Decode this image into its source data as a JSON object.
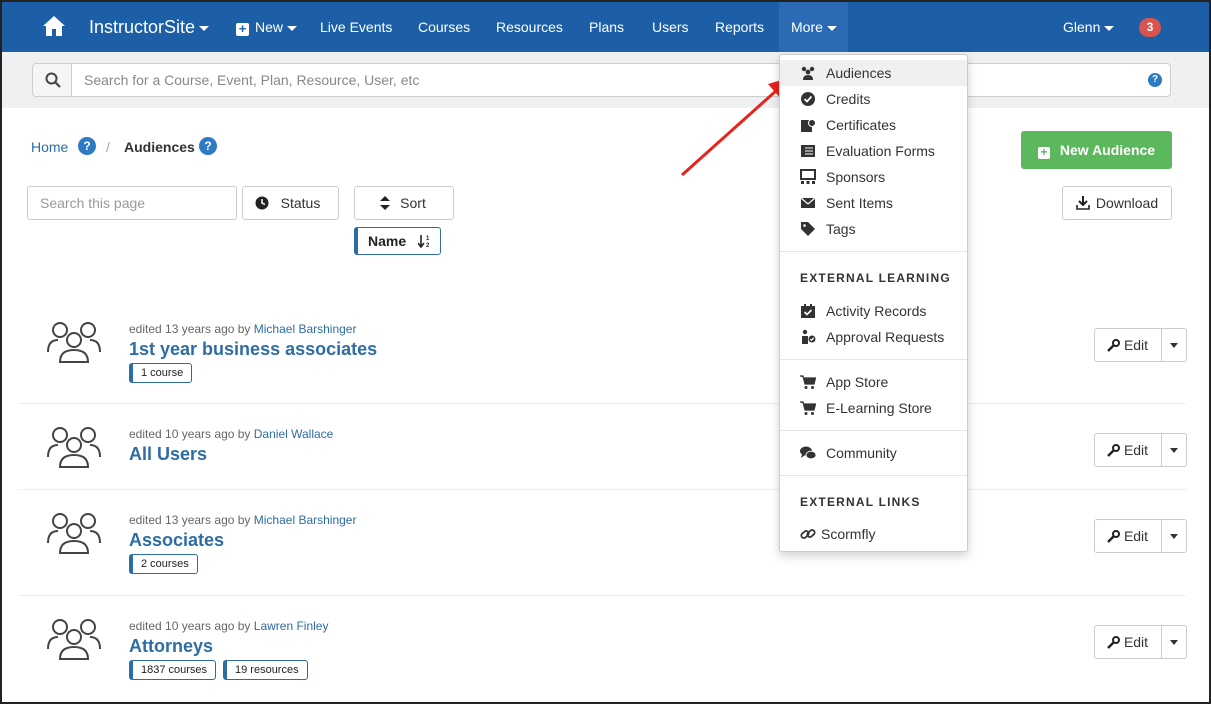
{
  "nav": {
    "brand": "InstructorSite",
    "new_label": "New",
    "items": [
      "Live Events",
      "Courses",
      "Resources",
      "Plans",
      "Users",
      "Reports"
    ],
    "more_label": "More",
    "user_label": "Glenn",
    "notification_count": "3"
  },
  "search": {
    "placeholder": "Search for a Course, Event, Plan, Resource, User, etc",
    "help": "?"
  },
  "breadcrumb": {
    "home": "Home",
    "current": "Audiences",
    "help": "?"
  },
  "toolbar": {
    "new_audience": "New Audience",
    "search_placeholder": "Search this page",
    "status_label": "Status",
    "sort_label": "Sort",
    "download_label": "Download",
    "sort_pill": "Name"
  },
  "audiences": [
    {
      "meta_prefix": "edited 13 years ago by ",
      "author": "Michael Barshinger",
      "name": "1st year business associates",
      "pills": [
        "1 course"
      ],
      "edit": "Edit"
    },
    {
      "meta_prefix": "edited 10 years ago by ",
      "author": "Daniel Wallace",
      "name": "All Users",
      "pills": [],
      "edit": "Edit"
    },
    {
      "meta_prefix": "edited 13 years ago by ",
      "author": "Michael Barshinger",
      "name": "Associates",
      "pills": [
        "2 courses"
      ],
      "edit": "Edit"
    },
    {
      "meta_prefix": "edited 10 years ago by ",
      "author": "Lawren Finley",
      "name": "Attorneys",
      "pills": [
        "1837 courses",
        "19 resources"
      ],
      "edit": "Edit"
    }
  ],
  "more_menu": {
    "group1": [
      {
        "label": "Audiences",
        "icon": "users-icon"
      },
      {
        "label": "Credits",
        "icon": "badge-check-icon"
      },
      {
        "label": "Certificates",
        "icon": "certificate-icon"
      },
      {
        "label": "Evaluation Forms",
        "icon": "list-icon"
      },
      {
        "label": "Sponsors",
        "icon": "sponsors-icon"
      },
      {
        "label": "Sent Items",
        "icon": "envelope-icon"
      },
      {
        "label": "Tags",
        "icon": "tag-icon"
      }
    ],
    "external_learning_header": "EXTERNAL LEARNING",
    "group2": [
      {
        "label": "Activity Records",
        "icon": "calendar-check-icon"
      },
      {
        "label": "Approval Requests",
        "icon": "person-check-icon"
      }
    ],
    "group3": [
      {
        "label": "App Store",
        "icon": "cart-icon"
      },
      {
        "label": "E-Learning Store",
        "icon": "cart-icon"
      }
    ],
    "group4": [
      {
        "label": "Community",
        "icon": "comments-icon"
      }
    ],
    "external_links_header": "EXTERNAL LINKS",
    "group5": [
      {
        "label": "Scormfly",
        "icon": "link-icon"
      }
    ]
  },
  "colors": {
    "nav_bg": "#1d5fa6",
    "link": "#2e6da4",
    "success": "#5cb85c",
    "danger": "#d9534f",
    "arrow": "#e8231e"
  }
}
